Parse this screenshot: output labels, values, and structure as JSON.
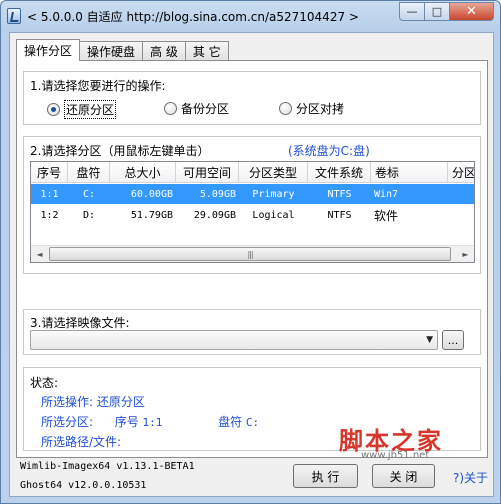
{
  "window": {
    "title": "< 5.0.0.0 自适应 http://blog.sina.com.cn/a527104427 >",
    "controls": {
      "minimize": "—",
      "maximize": "□",
      "close": "✕"
    }
  },
  "tabs": [
    {
      "label": "操作分区",
      "active": true
    },
    {
      "label": "操作硬盘",
      "active": false
    },
    {
      "label": "高 级",
      "active": false
    },
    {
      "label": "其 它",
      "active": false
    }
  ],
  "operation_group": {
    "label": "1.请选择您要进行的操作:",
    "options": [
      {
        "label": "还原分区",
        "checked": true
      },
      {
        "label": "备份分区",
        "checked": false
      },
      {
        "label": "分区对拷",
        "checked": false
      }
    ]
  },
  "partition_group": {
    "label": "2.请选择分区（用鼠标左键单击）",
    "hint": "(系统盘为C:盘)",
    "columns": [
      "序号",
      "盘符",
      "总大小",
      "可用空间",
      "分区类型",
      "文件系统",
      "卷标",
      "分区"
    ],
    "rows": [
      {
        "cells": [
          "1:1",
          "C:",
          "60.00GB",
          "5.09GB",
          "Primary",
          "NTFS",
          "Win7",
          ""
        ],
        "selected": true
      },
      {
        "cells": [
          "1:2",
          "D:",
          "51.79GB",
          "29.09GB",
          "Logical",
          "NTFS",
          "软件",
          ""
        ],
        "selected": false
      }
    ],
    "scroll_left": "◄",
    "scroll_right": "►",
    "scroll_grip": "|||"
  },
  "image_group": {
    "label": "3.请选择映像文件:",
    "combo_value": "",
    "combo_arrow": "▼",
    "browse_label": "..."
  },
  "status_group": {
    "label": "状态:",
    "operation_label": "所选操作:",
    "operation_value": "还原分区",
    "partition_label": "所选分区:",
    "partition_seq_label": "序号",
    "partition_seq_value": "1:1",
    "drive_label": "盘符",
    "drive_value": "C:",
    "path_label": "所选路径/文件:",
    "path_value": ""
  },
  "footer": {
    "version_line1": "Wimlib-Imagex64 v1.13.1-BETA1",
    "version_line2": "Ghost64 v12.0.0.10531",
    "execute_label": "执 行",
    "close_label": "关 闭",
    "about_label": "?)关于"
  },
  "watermark": {
    "main": "脚本之家",
    "sub": "www.jb51.net"
  },
  "colors": {
    "selection": "#3399ff",
    "link_blue": "#1f4fd6",
    "watermark_red": "#d6372c"
  }
}
